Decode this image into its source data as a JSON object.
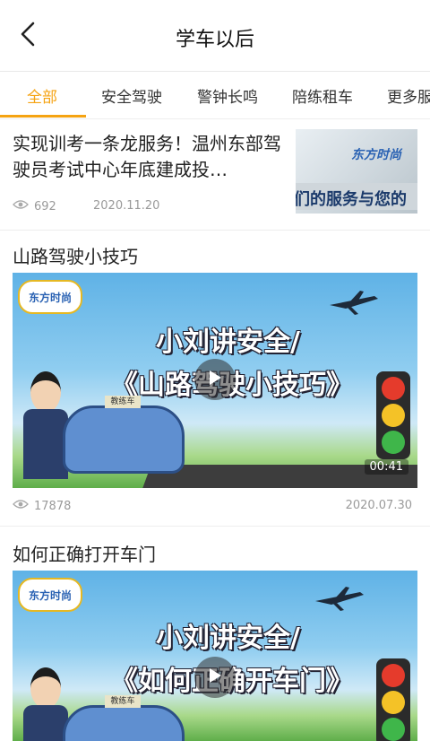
{
  "header": {
    "title": "学车以后"
  },
  "tabs": [
    {
      "label": "全部",
      "active": true
    },
    {
      "label": "安全驾驶",
      "active": false
    },
    {
      "label": "警钟长鸣",
      "active": false
    },
    {
      "label": "陪练租车",
      "active": false
    },
    {
      "label": "更多服务",
      "active": false
    }
  ],
  "colors": {
    "accent": "#f5a312"
  },
  "articles": [
    {
      "title": "实现训考一条龙服务！温州东部驾驶员考试中心年底建成投…",
      "views": "692",
      "date": "2020.11.20",
      "thumb_text": {
        "logo": "东方时尚",
        "caption": "们的服务与您的"
      }
    },
    {
      "title": "山路驾驶小技巧",
      "views": "17878",
      "date": "2020.07.30",
      "duration": "00:41",
      "banner": {
        "logo": "东方时尚",
        "line1": "小刘讲安全/",
        "line2": "《山路驾驶小技巧》",
        "car_sign": "教练车"
      }
    },
    {
      "title": "如何正确打开车门",
      "banner": {
        "logo": "东方时尚",
        "line1": "小刘讲安全/",
        "line2": "《如何正确开车门》",
        "car_sign": "教练车"
      }
    }
  ]
}
